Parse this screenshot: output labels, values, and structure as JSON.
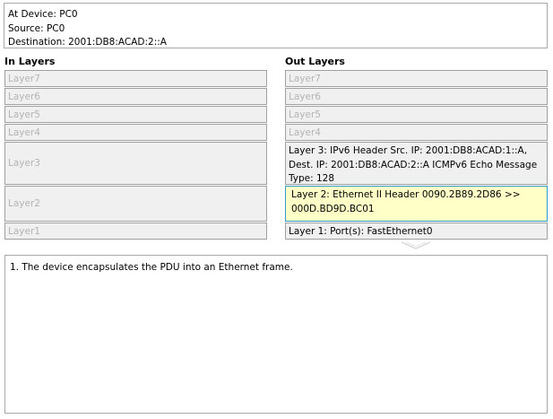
{
  "header": {
    "device": "At Device: PC0",
    "source": "Source: PC0",
    "destination": "Destination: 2001:DB8:ACAD:2::A"
  },
  "in_layers": {
    "title": "In Layers",
    "layers": [
      "Layer7",
      "Layer6",
      "Layer5",
      "Layer4",
      "Layer3",
      "Layer2",
      "Layer1"
    ]
  },
  "out_layers": {
    "title": "Out Layers",
    "layers": [
      "Layer7",
      "Layer6",
      "Layer5",
      "Layer4",
      "Layer 3: IPv6 Header Src. IP: 2001:DB8:ACAD:1::A, Dest. IP: 2001:DB8:ACAD:2::A ICMPv6 Echo Message Type: 128",
      "Layer 2: Ethernet II Header 0090.2B89.2D86 >> 000D.BD9D.BC01",
      "Layer 1: Port(s): FastEthernet0"
    ]
  },
  "details": {
    "text": "1. The device encapsulates the PDU into an Ethernet frame."
  }
}
